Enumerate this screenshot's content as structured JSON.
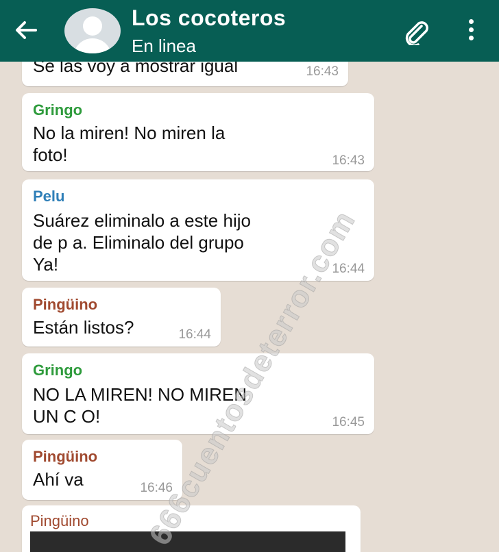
{
  "header": {
    "title": "Los cocoteros",
    "status": "En linea"
  },
  "colors": {
    "header_bg": "#075e54",
    "chat_bg": "#e6ddd4",
    "sender_green": "#2e9b3c",
    "sender_blue": "#2f7fb8",
    "sender_brown": "#a0492f"
  },
  "messages": [
    {
      "sender": "",
      "text": "Se las voy a mostrar igual",
      "time": "16:43"
    },
    {
      "sender": "Gringo",
      "text": "No la miren! No miren la\nfoto!",
      "time": "16:43"
    },
    {
      "sender": "Pelu",
      "text": "Suárez eliminalo a este hijo\nde p   a. Eliminalo del grupo\nYa!",
      "time": "16:44"
    },
    {
      "sender": "Pingüino",
      "text": "Están listos?",
      "time": "16:44"
    },
    {
      "sender": "Gringo",
      "text": "NO LA MIREN! NO MIREN\nUN C      O!",
      "time": "16:45"
    },
    {
      "sender": "Pingüino",
      "text": "Ahí va",
      "time": "16:46"
    },
    {
      "sender": "Pingüino",
      "text": "",
      "time": ""
    }
  ],
  "watermark": "666cuentosdeterror.com"
}
